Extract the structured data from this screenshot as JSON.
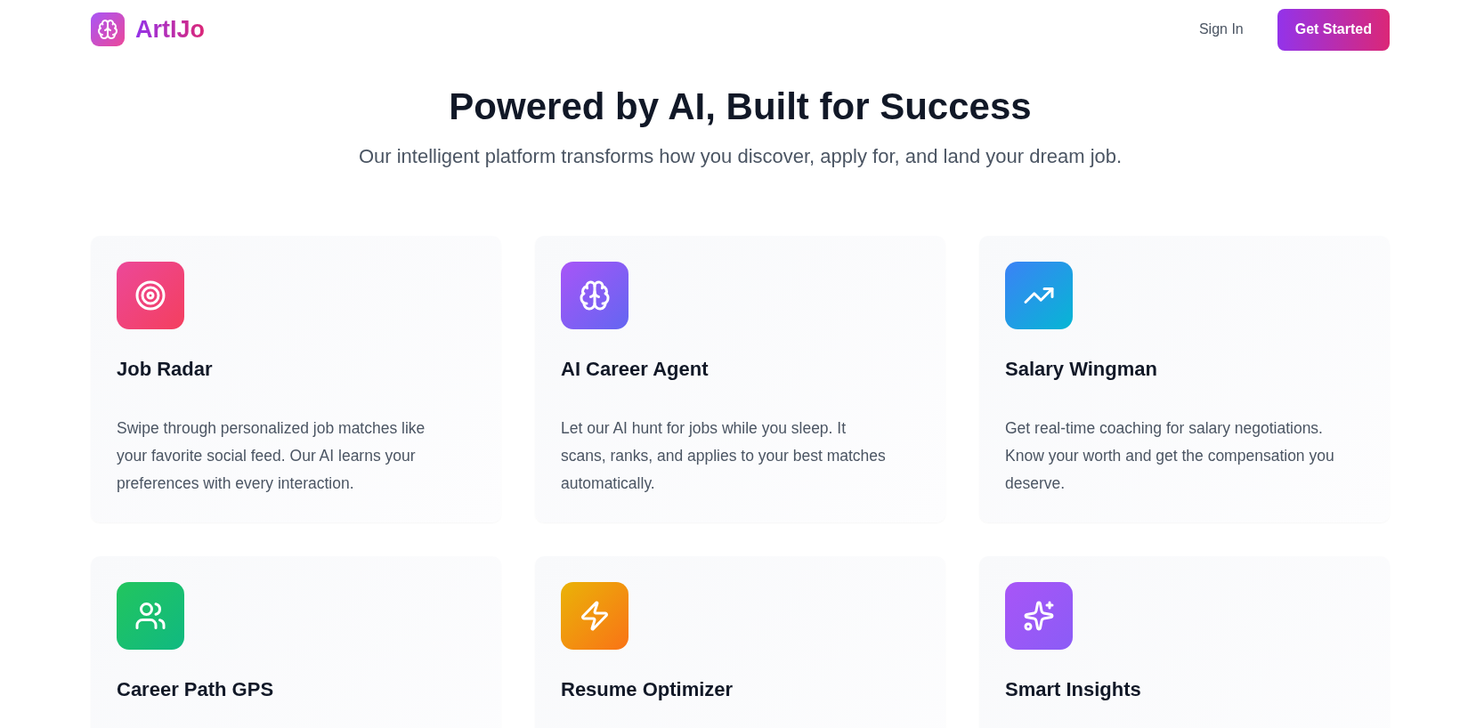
{
  "header": {
    "brand": "ArtIJo",
    "sign_in": "Sign In",
    "cta": "Get Started"
  },
  "hero": {
    "title": "Powered by AI, Built for Success",
    "subtitle": "Our intelligent platform transforms how you discover, apply for, and land your dream job."
  },
  "features": [
    {
      "kind": "target",
      "title": "Job Radar",
      "description": "Swipe through personalized job matches like your favorite social feed. Our AI learns your preferences with every interaction."
    },
    {
      "kind": "brain",
      "title": "AI Career Agent",
      "description": "Let our AI hunt for jobs while you sleep. It scans, ranks, and applies to your best matches automatically."
    },
    {
      "kind": "trend",
      "title": "Salary Wingman",
      "description": "Get real-time coaching for salary negotiations. Know your worth and get the compensation you deserve."
    },
    {
      "kind": "users",
      "title": "Career Path GPS"
    },
    {
      "kind": "zap",
      "title": "Resume Optimizer"
    },
    {
      "kind": "sparkles",
      "title": "Smart Insights"
    }
  ]
}
